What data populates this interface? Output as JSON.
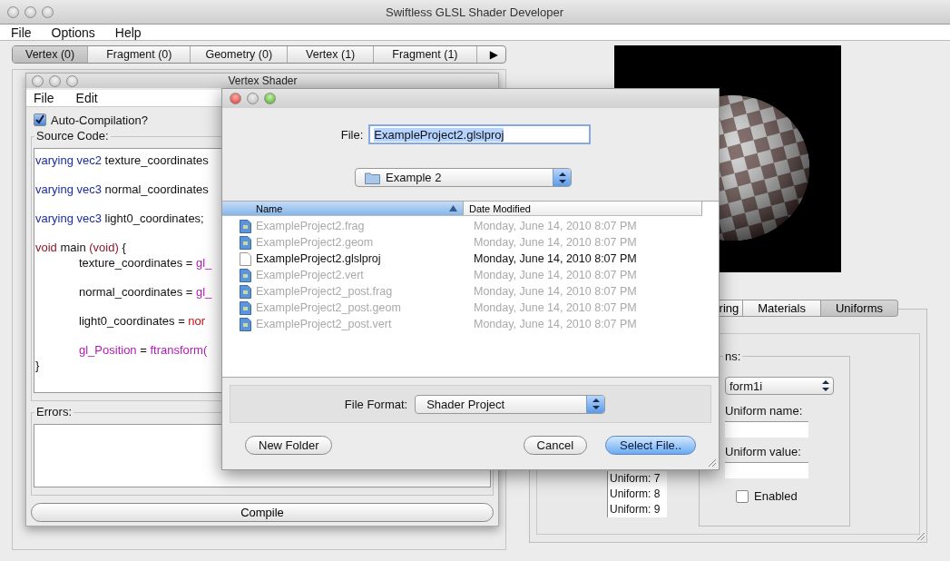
{
  "window": {
    "title": "Swiftless GLSL Shader Developer"
  },
  "menu": [
    "File",
    "Options",
    "Help"
  ],
  "shader_tabs": [
    {
      "label": "Vertex (0)",
      "selected": true
    },
    {
      "label": "Fragment (0)",
      "selected": false
    },
    {
      "label": "Geometry (0)",
      "selected": false
    },
    {
      "label": "Vertex (1)",
      "selected": false
    },
    {
      "label": "Fragment (1)",
      "selected": false
    }
  ],
  "shader_tabs_scroll": "▶",
  "vertex_shader": {
    "title": "Vertex Shader",
    "menu": [
      "File",
      "Edit"
    ],
    "auto_compilation": {
      "label": "Auto-Compilation?",
      "checked": true
    },
    "source_label": "Source Code:",
    "code_lines": [
      {
        "kind": "code",
        "indent": false,
        "tokens": [
          {
            "kind": "keyword",
            "text": "varying vec2"
          },
          {
            "kind": "plain",
            "text": " texture_coordinates"
          }
        ]
      },
      {
        "kind": "blank"
      },
      {
        "kind": "code",
        "indent": false,
        "tokens": [
          {
            "kind": "keyword",
            "text": "varying vec3"
          },
          {
            "kind": "plain",
            "text": " normal_coordinates"
          }
        ]
      },
      {
        "kind": "blank"
      },
      {
        "kind": "code",
        "indent": false,
        "tokens": [
          {
            "kind": "keyword",
            "text": "varying vec3"
          },
          {
            "kind": "plain",
            "text": " light0_coordinates;"
          }
        ]
      },
      {
        "kind": "blank"
      },
      {
        "kind": "code",
        "indent": false,
        "tokens": [
          {
            "kind": "type",
            "text": "void"
          },
          {
            "kind": "plain",
            "text": " main "
          },
          {
            "kind": "type",
            "text": "(void)"
          },
          {
            "kind": "plain",
            "text": " {"
          }
        ]
      },
      {
        "kind": "code",
        "indent": true,
        "tokens": [
          {
            "kind": "plain",
            "text": "texture_coordinates = "
          },
          {
            "kind": "builtin",
            "text": "gl_"
          }
        ]
      },
      {
        "kind": "blank"
      },
      {
        "kind": "code",
        "indent": true,
        "tokens": [
          {
            "kind": "plain",
            "text": "normal_coordinates = "
          },
          {
            "kind": "builtin",
            "text": "gl_"
          }
        ]
      },
      {
        "kind": "blank"
      },
      {
        "kind": "code",
        "indent": true,
        "tokens": [
          {
            "kind": "plain",
            "text": "light0_coordinates = "
          },
          {
            "kind": "function",
            "text": "nor"
          }
        ]
      },
      {
        "kind": "blank"
      },
      {
        "kind": "code",
        "indent": true,
        "tokens": [
          {
            "kind": "builtin",
            "text": "gl_Position"
          },
          {
            "kind": "plain",
            "text": " = "
          },
          {
            "kind": "builtin",
            "text": "ftransform("
          }
        ]
      },
      {
        "kind": "code",
        "indent": false,
        "tokens": [
          {
            "kind": "plain",
            "text": "}"
          }
        ]
      }
    ],
    "errors_label": "Errors:",
    "compile_button": "Compile"
  },
  "properties_panel": {
    "tabs": [
      {
        "label": "ring",
        "selected": false
      },
      {
        "label": "Materials",
        "selected": false
      },
      {
        "label": "Uniforms",
        "selected": true
      }
    ],
    "uniform_list": [
      "Uniform: 7",
      "Uniform: 8",
      "Uniform: 9"
    ],
    "group_label": "ns:",
    "type_select": "form1i",
    "name_label": "Uniform name:",
    "value_label": "Uniform value:",
    "enabled": {
      "label": "Enabled",
      "checked": false
    }
  },
  "file_dialog": {
    "file_label": "File:",
    "file_name": "ExampleProject2.glslproj",
    "folder": "Example 2",
    "columns": [
      {
        "label": "Name",
        "selected": true
      },
      {
        "label": "Date Modified",
        "selected": false
      }
    ],
    "files": [
      {
        "kind": "shader",
        "name": "ExampleProject2.frag",
        "date": "Monday, June 14, 2010 8:07 PM",
        "disabled": true
      },
      {
        "kind": "shader",
        "name": "ExampleProject2.geom",
        "date": "Monday, June 14, 2010 8:07 PM",
        "disabled": true
      },
      {
        "kind": "document",
        "name": "ExampleProject2.glslproj",
        "date": "Monday, June 14, 2010 8:07 PM",
        "disabled": false
      },
      {
        "kind": "shader",
        "name": "ExampleProject2.vert",
        "date": "Monday, June 14, 2010 8:07 PM",
        "disabled": true
      },
      {
        "kind": "shader",
        "name": "ExampleProject2_post.frag",
        "date": "Monday, June 14, 2010 8:07 PM",
        "disabled": true
      },
      {
        "kind": "shader",
        "name": "ExampleProject2_post.geom",
        "date": "Monday, June 14, 2010 8:07 PM",
        "disabled": true
      },
      {
        "kind": "shader",
        "name": "ExampleProject2_post.vert",
        "date": "Monday, June 14, 2010 8:07 PM",
        "disabled": true
      }
    ],
    "format_label": "File Format:",
    "format": "Shader Project",
    "buttons": [
      {
        "label": "New Folder",
        "kind": "secondary"
      },
      {
        "label": "Cancel",
        "kind": "secondary"
      },
      {
        "label": "Select File..",
        "kind": "default"
      }
    ]
  }
}
